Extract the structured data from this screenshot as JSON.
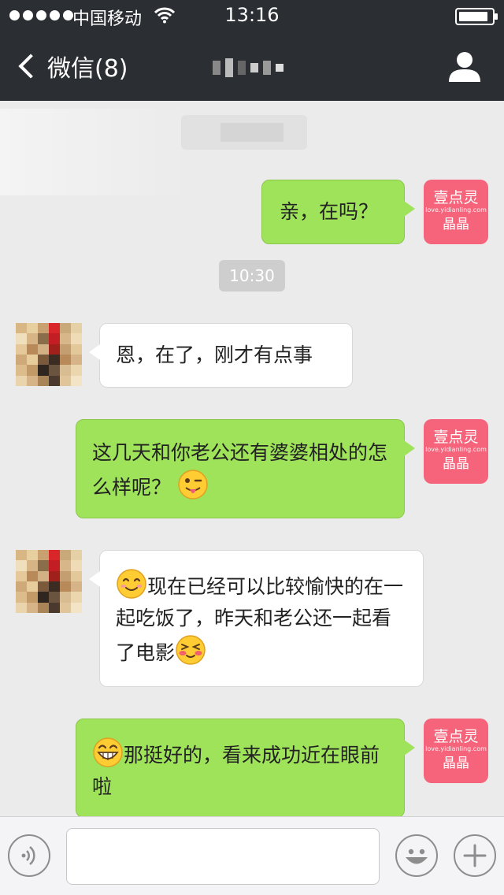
{
  "status_bar": {
    "carrier": "中国移动",
    "time": "13:16"
  },
  "nav": {
    "back_label": "微信(8)"
  },
  "timestamps": {
    "second": "10:30"
  },
  "messages": [
    {
      "side": "right",
      "text": "亲，在吗？"
    },
    {
      "side": "left",
      "text": "恩，在了，刚才有点事"
    },
    {
      "side": "right",
      "text": "这几天和你老公还有婆婆相处的怎么样呢？"
    },
    {
      "side": "left",
      "text": "现在已经可以比较愉快的在一起吃饭了，昨天和老公还一起看了电影"
    },
    {
      "side": "right",
      "text": "那挺好的，看来成功近在眼前啦"
    }
  ],
  "my_avatar": {
    "brand": "壹点灵",
    "domain": "love.yidianling.com",
    "name": "晶晶",
    "color": "#f6647b"
  },
  "colors": {
    "sent_bubble": "#9fe35a",
    "received_bubble": "#ffffff",
    "nav_background": "#2b2f33",
    "chat_background": "#ebebeb"
  },
  "icons": {
    "back": "chevron-left-icon",
    "profile": "user-icon",
    "voice": "voice-icon",
    "emoji": "emoji-icon",
    "more": "plus-icon"
  }
}
